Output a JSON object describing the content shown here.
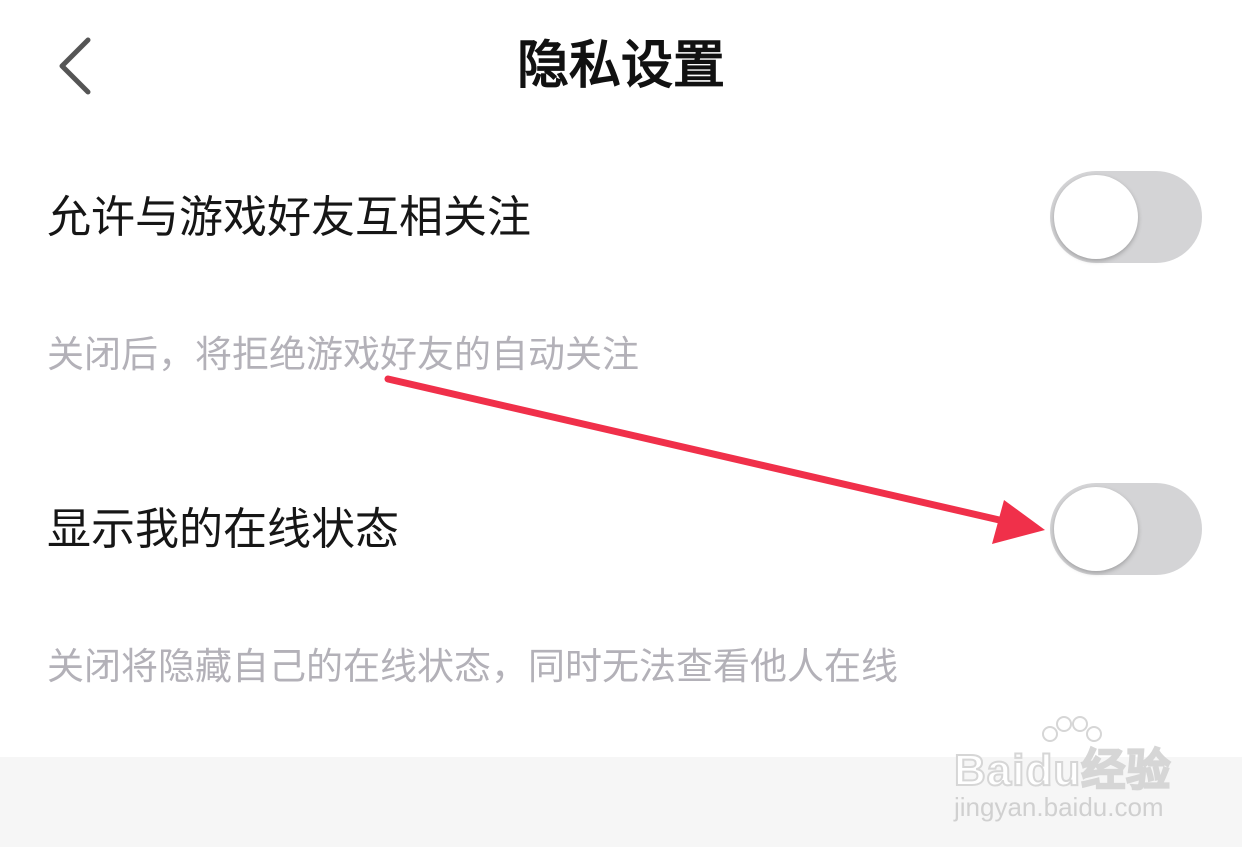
{
  "header": {
    "title": "隐私设置",
    "back_icon": "chevron-left-icon"
  },
  "settings": [
    {
      "label": "允许与游戏好友互相关注",
      "description": "关闭后，将拒绝游戏好友的自动关注",
      "enabled": false
    },
    {
      "label": "显示我的在线状态",
      "description": "关闭将隐藏自己的在线状态，同时无法查看他人在线",
      "enabled": false
    }
  ],
  "annotation": {
    "type": "arrow",
    "color": "#f0304a"
  },
  "watermark": {
    "logo": "Baidu经验",
    "url": "jingyan.baidu.com"
  },
  "colors": {
    "toggle_off": "#d4d4d6",
    "knob": "#ffffff",
    "description_text": "#b3b1b8",
    "footer_bg": "#f6f6f6"
  }
}
